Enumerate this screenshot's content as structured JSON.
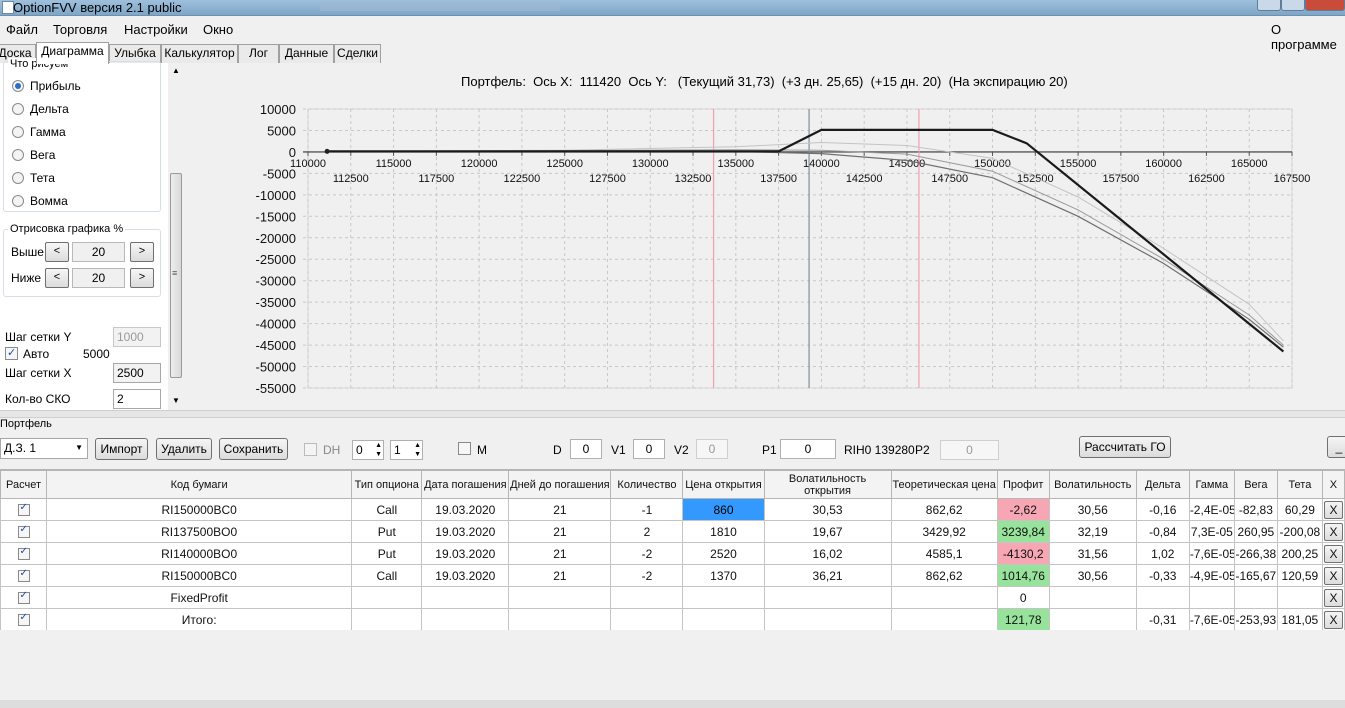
{
  "window": {
    "title": "OptionFVV версия 2.1 public"
  },
  "menu": {
    "items": [
      "Файл",
      "Торговля",
      "Настройки",
      "Окно"
    ],
    "right": "О программе"
  },
  "tabs": [
    "Доска",
    "Диаграмма",
    "Улыбка",
    "Калькулятор",
    "Лог",
    "Данные",
    "Сделки"
  ],
  "draw_group": {
    "title": "Что рисуем",
    "options": [
      "Прибыль",
      "Дельта",
      "Гамма",
      "Вега",
      "Тета",
      "Вомма"
    ],
    "selected": "Прибыль"
  },
  "render_group": {
    "title": "Отрисовка графика %",
    "above_label": "Выше",
    "above_value": "20",
    "below_label": "Ниже",
    "below_value": "20",
    "dec": "<",
    "inc": ">"
  },
  "grid_settings": {
    "y_step_label": "Шаг сетки Y",
    "y_step_value": "1000",
    "auto_label": "Авто",
    "auto_value": "5000",
    "x_step_label": "Шаг сетки X",
    "x_step_value": "2500",
    "sko_label": "Кол-во СКО",
    "sko_value": "2"
  },
  "chart_data": {
    "type": "line",
    "title": "Портфель:  Ось X:  111420  Ось Y:   (Текущий 31,73)  (+3 дн. 25,65)  (+15 дн. 20)  (На экспирацию 20)",
    "xlim": [
      110000,
      167500
    ],
    "ylim": [
      -55000,
      10000
    ],
    "x_ticks_top": [
      110000,
      115000,
      120000,
      125000,
      130000,
      135000,
      140000,
      145000,
      150000,
      155000,
      160000,
      165000
    ],
    "x_ticks_bottom": [
      112500,
      117500,
      122500,
      127500,
      132500,
      137500,
      142500,
      147500,
      152500,
      157500,
      162500,
      167500
    ],
    "y_ticks": [
      10000,
      5000,
      0,
      -5000,
      -10000,
      -15000,
      -20000,
      -25000,
      -30000,
      -35000,
      -40000,
      -45000,
      -50000,
      -55000
    ],
    "vlines": [
      {
        "x": 133700,
        "color": "#f2a0b0"
      },
      {
        "x": 139280,
        "color": "#7f8fa0"
      },
      {
        "x": 145700,
        "color": "#f2a0b0"
      }
    ],
    "series": [
      {
        "name": "На экспирацию",
        "color": "#1a1a1a",
        "width": 2.2,
        "points": [
          [
            111000,
            122
          ],
          [
            137500,
            122
          ],
          [
            140000,
            5122
          ],
          [
            150000,
            5122
          ],
          [
            152000,
            2000
          ],
          [
            167000,
            -46500
          ]
        ]
      },
      {
        "name": "Текущий",
        "color": "#6f6f6f",
        "width": 1.2,
        "points": [
          [
            111000,
            50
          ],
          [
            125000,
            150
          ],
          [
            135000,
            100
          ],
          [
            140000,
            -400
          ],
          [
            145000,
            -2000
          ],
          [
            150000,
            -6000
          ],
          [
            155000,
            -15000
          ],
          [
            160000,
            -26000
          ],
          [
            165000,
            -39000
          ],
          [
            167000,
            -45500
          ]
        ]
      },
      {
        "name": "+3 дн.",
        "color": "#9a9a9a",
        "width": 1.0,
        "points": [
          [
            111000,
            80
          ],
          [
            125000,
            300
          ],
          [
            135000,
            500
          ],
          [
            140000,
            400
          ],
          [
            145000,
            -500
          ],
          [
            150000,
            -4500
          ],
          [
            155000,
            -13500
          ],
          [
            160000,
            -25000
          ],
          [
            165000,
            -38000
          ],
          [
            167000,
            -45000
          ]
        ]
      },
      {
        "name": "+15 дн.",
        "color": "#c4c4c4",
        "width": 1.0,
        "points": [
          [
            111000,
            100
          ],
          [
            125000,
            400
          ],
          [
            135000,
            1200
          ],
          [
            140000,
            2200
          ],
          [
            145000,
            1500
          ],
          [
            150000,
            -1500
          ],
          [
            155000,
            -10500
          ],
          [
            160000,
            -22500
          ],
          [
            165000,
            -35500
          ],
          [
            167000,
            -44000
          ]
        ]
      }
    ]
  },
  "portfolio": {
    "label": "Портфель",
    "account": "Д.З. 1",
    "import": "Импорт",
    "delete": "Удалить",
    "save": "Сохранить",
    "dh_label": "DH",
    "dh_a": "0",
    "dh_b": "1",
    "m_label": "M",
    "d_label": "D",
    "d_value": "0",
    "v1_label": "V1",
    "v1_value": "0",
    "v2_label": "V2",
    "v2_value": "0",
    "p1_label": "P1",
    "p1_value": "0",
    "rih_label": "RIH0 139280",
    "p2_label": "P2",
    "p2_value": "0",
    "calc_go": "Рассчитать ГО",
    "min_btn": "_"
  },
  "table": {
    "headers": [
      "Расчет",
      "Код бумаги",
      "Тип опциона",
      "Дата погашения",
      "Дней до погашения",
      "Количество",
      "Цена открытия",
      "Волатильность открытия",
      "Теоретическая цена",
      "Профит",
      "Волатильность",
      "Дельта",
      "Гамма",
      "Вега",
      "Тета",
      "X"
    ],
    "rows": [
      {
        "code": "RI150000BC0",
        "type": "Call",
        "date": "19.03.2020",
        "days": "21",
        "qty": "-1",
        "open": "860",
        "vol_open": "30,53",
        "theo": "862,62",
        "profit": "-2,62",
        "profit_cls": "neg",
        "vol": "30,56",
        "delta": "-0,16",
        "gamma": "-2,4E-05",
        "vega": "-82,83",
        "theta": "60,29",
        "sel": true
      },
      {
        "code": "RI137500BO0",
        "type": "Put",
        "date": "19.03.2020",
        "days": "21",
        "qty": "2",
        "open": "1810",
        "vol_open": "19,67",
        "theo": "3429,92",
        "profit": "3239,84",
        "profit_cls": "pos",
        "vol": "32,19",
        "delta": "-0,84",
        "gamma": "7,3E-05",
        "vega": "260,95",
        "theta": "-200,08"
      },
      {
        "code": "RI140000BO0",
        "type": "Put",
        "date": "19.03.2020",
        "days": "21",
        "qty": "-2",
        "open": "2520",
        "vol_open": "16,02",
        "theo": "4585,1",
        "profit": "-4130,2",
        "profit_cls": "neg",
        "vol": "31,56",
        "delta": "1,02",
        "gamma": "-7,6E-05",
        "vega": "-266,38",
        "theta": "200,25"
      },
      {
        "code": "RI150000BC0",
        "type": "Call",
        "date": "19.03.2020",
        "days": "21",
        "qty": "-2",
        "open": "1370",
        "vol_open": "36,21",
        "theo": "862,62",
        "profit": "1014,76",
        "profit_cls": "pos",
        "vol": "30,56",
        "delta": "-0,33",
        "gamma": "-4,9E-05",
        "vega": "-165,67",
        "theta": "120,59"
      },
      {
        "code": "FixedProfit",
        "type": "",
        "date": "",
        "days": "",
        "qty": "",
        "open": "",
        "vol_open": "",
        "theo": "",
        "profit": "0",
        "profit_cls": "",
        "vol": "",
        "delta": "",
        "gamma": "",
        "vega": "",
        "theta": ""
      },
      {
        "code": "Итого:",
        "type": "",
        "date": "",
        "days": "",
        "qty": "",
        "open": "",
        "vol_open": "",
        "theo": "",
        "profit": "121,78",
        "profit_cls": "pos",
        "vol": "",
        "delta": "-0,31",
        "gamma": "-7,6E-05",
        "vega": "-253,93",
        "theta": "181,05"
      }
    ],
    "x_label": "X"
  }
}
